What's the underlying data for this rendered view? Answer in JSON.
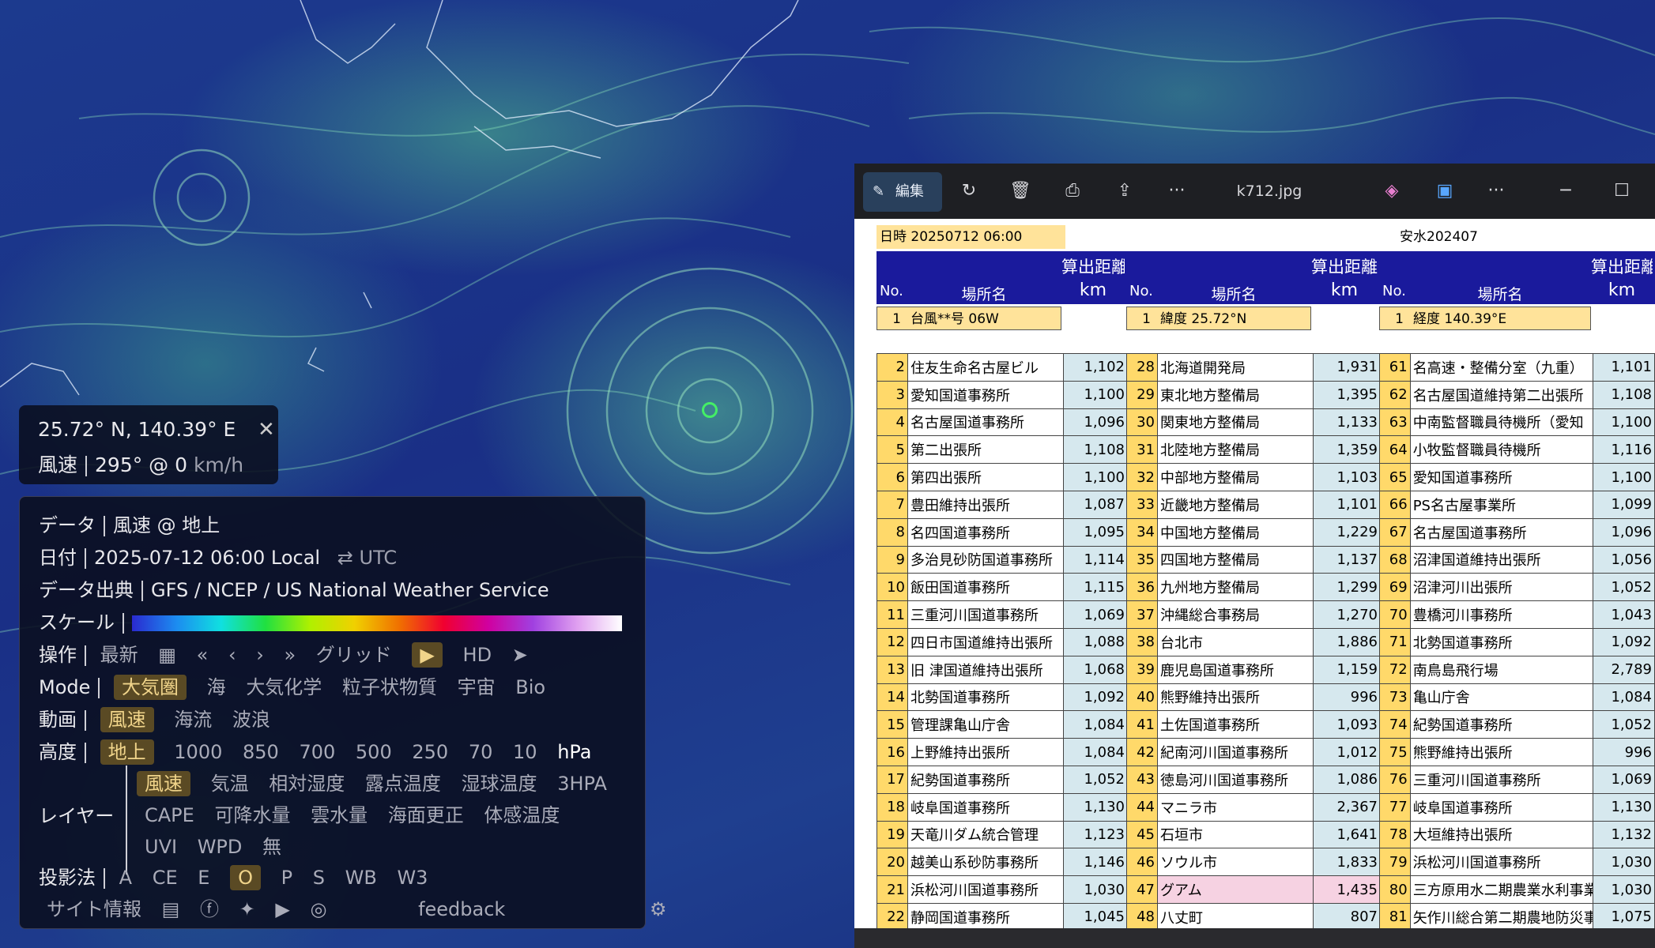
{
  "map": {
    "coord_panel": {
      "coords": "25.72° N, 140.39° E",
      "close_icon": "✕",
      "label": "風速",
      "value": "295° @ 0",
      "unit": "km/h"
    },
    "menu": {
      "data_label": "データ",
      "data_value": "風速 @ 地上",
      "date_label": "日付",
      "date_value": "2025-07-12 06:00 Local",
      "utc_toggle": "UTC",
      "source_label": "データ出典",
      "source_value": "GFS / NCEP / US National Weather Service",
      "scale_label": "スケール",
      "control_label": "操作",
      "latest": "最新",
      "grid": "グリッド",
      "hd": "HD",
      "mode_label": "Mode",
      "modes": [
        "大気圏",
        "海",
        "大気化学",
        "粒子状物質",
        "宇宙",
        "Bio"
      ],
      "anim_label": "動画",
      "anims": [
        "風速",
        "海流",
        "波浪"
      ],
      "height_label": "高度",
      "heights": [
        "地上",
        "1000",
        "850",
        "700",
        "500",
        "250",
        "70",
        "10",
        "hPa"
      ],
      "layer_label": "レイヤー",
      "layers_row1": [
        "風速",
        "気温",
        "相対湿度",
        "露点温度",
        "湿球温度",
        "3HPA"
      ],
      "layers_row2": [
        "CAPE",
        "可降水量",
        "雲水量",
        "海面更正",
        "体感温度"
      ],
      "layers_row3": [
        "UVI",
        "WPD",
        "無"
      ],
      "proj_label": "投影法",
      "projections": [
        "A",
        "CE",
        "E",
        "O",
        "P",
        "S",
        "WB",
        "W3"
      ],
      "site_info": "サイト情報",
      "feedback": "feedback"
    }
  },
  "viewer": {
    "edit_label": "編集",
    "filename": "k712.jpg",
    "more": "···"
  },
  "sheet": {
    "datetime_label": "日時",
    "datetime_value": "20250712 06:00",
    "header_right": "安水202407",
    "col_no": "No.",
    "col_place": "場所名",
    "col_dist": "算出距離",
    "col_km": "km",
    "info": [
      {
        "no": "1",
        "text": "台風**号 06W"
      },
      {
        "no": "1",
        "text": "緯度 25.72°N"
      },
      {
        "no": "1",
        "text": "経度 140.39°E"
      }
    ],
    "col1": [
      [
        "2",
        "住友生命名古屋ビル",
        "1,102"
      ],
      [
        "3",
        "愛知国道事務所",
        "1,100"
      ],
      [
        "4",
        "名古屋国道事務所",
        "1,096"
      ],
      [
        "5",
        "第二出張所",
        "1,108"
      ],
      [
        "6",
        "第四出張所",
        "1,100"
      ],
      [
        "7",
        "豊田維持出張所",
        "1,087"
      ],
      [
        "8",
        "名四国道事務所",
        "1,095"
      ],
      [
        "9",
        "多治見砂防国道事務所",
        "1,114"
      ],
      [
        "10",
        "飯田国道事務所",
        "1,115"
      ],
      [
        "11",
        "三重河川国道事務所",
        "1,069"
      ],
      [
        "12",
        "四日市国道維持出張所",
        "1,088"
      ],
      [
        "13",
        "旧 津国道維持出張所",
        "1,068"
      ],
      [
        "14",
        "北勢国道事務所",
        "1,092"
      ],
      [
        "15",
        "管理課亀山庁舎",
        "1,084"
      ],
      [
        "16",
        "上野維持出張所",
        "1,084"
      ],
      [
        "17",
        "紀勢国道事務所",
        "1,052"
      ],
      [
        "18",
        "岐阜国道事務所",
        "1,130"
      ],
      [
        "19",
        "天竜川ダム統合管理",
        "1,123"
      ],
      [
        "20",
        "越美山系砂防事務所",
        "1,146"
      ],
      [
        "21",
        "浜松河川国道事務所",
        "1,030"
      ],
      [
        "22",
        "静岡国道事務所",
        "1,045"
      ]
    ],
    "col2": [
      [
        "28",
        "北海道開発局",
        "1,931"
      ],
      [
        "29",
        "東北地方整備局",
        "1,395"
      ],
      [
        "30",
        "関東地方整備局",
        "1,133"
      ],
      [
        "31",
        "北陸地方整備局",
        "1,359"
      ],
      [
        "32",
        "中部地方整備局",
        "1,103"
      ],
      [
        "33",
        "近畿地方整備局",
        "1,101"
      ],
      [
        "34",
        "中国地方整備局",
        "1,229"
      ],
      [
        "35",
        "四国地方整備局",
        "1,137"
      ],
      [
        "36",
        "九州地方整備局",
        "1,299"
      ],
      [
        "37",
        "沖縄総合事務局",
        "1,270"
      ],
      [
        "38",
        "台北市",
        "1,886"
      ],
      [
        "39",
        "鹿児島国道事務所",
        "1,159"
      ],
      [
        "40",
        "熊野維持出張所",
        "996"
      ],
      [
        "41",
        "土佐国道事務所",
        "1,093"
      ],
      [
        "42",
        "紀南河川国道事務所",
        "1,012"
      ],
      [
        "43",
        "徳島河川国道事務所",
        "1,086"
      ],
      [
        "44",
        "マニラ市",
        "2,367"
      ],
      [
        "45",
        "石垣市",
        "1,641"
      ],
      [
        "46",
        "ソウル市",
        "1,833"
      ],
      [
        "47",
        "グアム",
        "1,435"
      ],
      [
        "48",
        "八丈町",
        "807"
      ]
    ],
    "col3": [
      [
        "61",
        "名高速・整備分室（九重）",
        "1,101"
      ],
      [
        "62",
        "名古屋国道維持第二出張所",
        "1,108"
      ],
      [
        "63",
        "中南監督職員待機所（愛知",
        "1,100"
      ],
      [
        "64",
        "小牧監督職員待機所",
        "1,116"
      ],
      [
        "65",
        "愛知国道事務所",
        "1,100"
      ],
      [
        "66",
        "PS名古屋事業所",
        "1,099"
      ],
      [
        "67",
        "名古屋国道事務所",
        "1,096"
      ],
      [
        "68",
        "沼津国道維持出張所",
        "1,056"
      ],
      [
        "69",
        "沼津河川出張所",
        "1,052"
      ],
      [
        "70",
        "豊橋河川事務所",
        "1,043"
      ],
      [
        "71",
        "北勢国道事務所",
        "1,092"
      ],
      [
        "72",
        "南鳥島飛行場",
        "2,789"
      ],
      [
        "73",
        "亀山庁舎",
        "1,084"
      ],
      [
        "74",
        "紀勢国道事務所",
        "1,052"
      ],
      [
        "75",
        "熊野維持出張所",
        "996"
      ],
      [
        "76",
        "三重河川国道事務所",
        "1,069"
      ],
      [
        "77",
        "岐阜国道事務所",
        "1,130"
      ],
      [
        "78",
        "大垣維持出張所",
        "1,132"
      ],
      [
        "79",
        "浜松河川国道事務所",
        "1,030"
      ],
      [
        "80",
        "三方原用水二期農業水利事業",
        "1,030"
      ],
      [
        "81",
        "矢作川総合第二期農地防災事",
        "1,075"
      ]
    ]
  }
}
